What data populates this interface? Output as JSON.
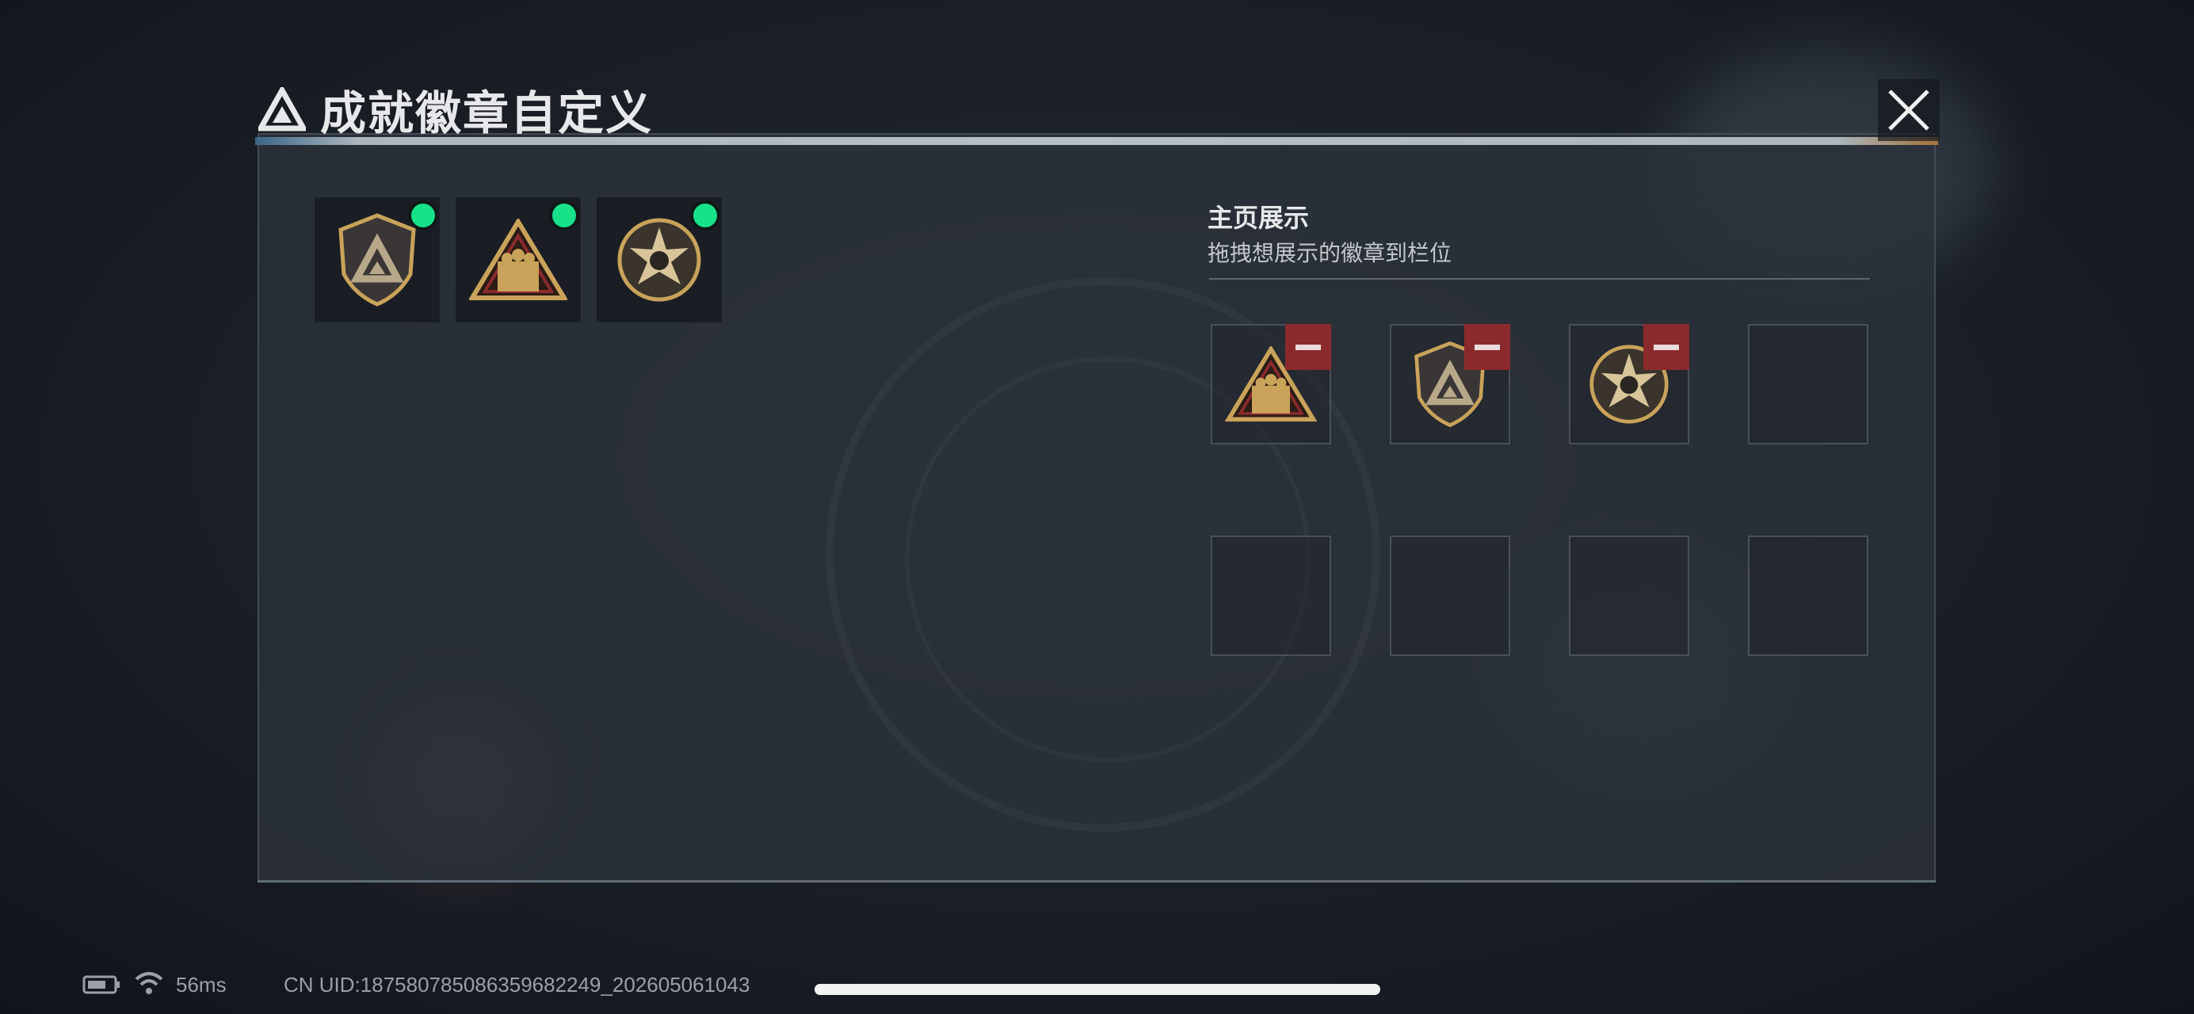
{
  "dialog": {
    "title": "成就徽章自定义",
    "close_icon": "close-icon"
  },
  "owned_badges": [
    {
      "icon": "shield-delta-badge-icon",
      "equipped": true
    },
    {
      "icon": "soldiers-triangle-badge-icon",
      "equipped": true
    },
    {
      "icon": "star-skull-badge-icon",
      "equipped": true
    }
  ],
  "showcase": {
    "title": "主页展示",
    "subtitle": "拖拽想展示的徽章到栏位",
    "slots": [
      {
        "badge": "soldiers-triangle-badge-icon"
      },
      {
        "badge": "shield-delta-badge-icon"
      },
      {
        "badge": "star-skull-badge-icon"
      },
      {
        "badge": null
      },
      {
        "badge": null
      },
      {
        "badge": null
      },
      {
        "badge": null
      },
      {
        "badge": null
      }
    ]
  },
  "status_bar": {
    "ping": "56ms",
    "uid": "CN UID:18758078508635968224​9_202605061043"
  },
  "colors": {
    "equipped_dot": "#17e28a",
    "remove_button": "#8b2a2c",
    "badge_gold": "#c9a35a"
  }
}
